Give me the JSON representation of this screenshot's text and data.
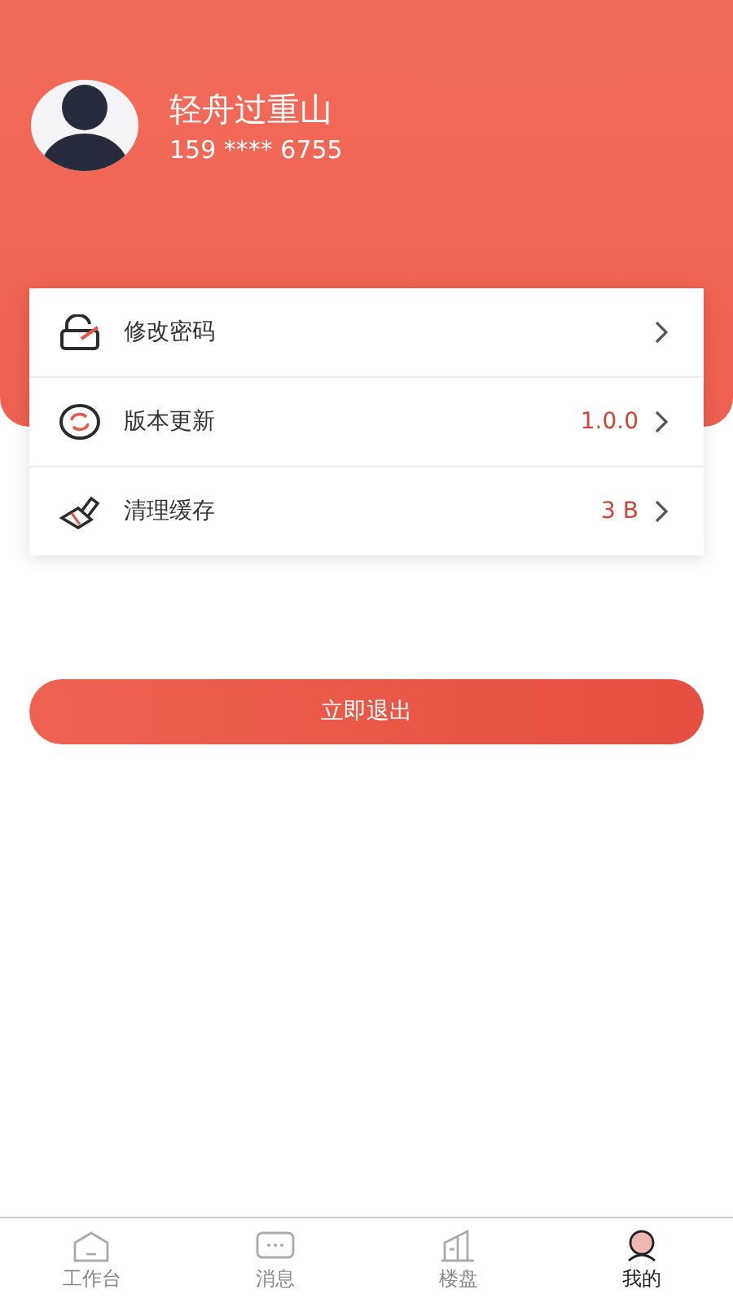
{
  "profile": {
    "name": "轻舟过重山",
    "phone": "159 **** 6755"
  },
  "menu": [
    {
      "kind": "password",
      "label": "修改密码"
    },
    {
      "kind": "update",
      "label": "版本更新",
      "value": "1.0.0"
    },
    {
      "kind": "cache",
      "label": "清理缓存",
      "value": "3 B"
    }
  ],
  "logout_button": "立即退出",
  "tabs": [
    {
      "kind": "workbench",
      "label": "工作台",
      "selected": false
    },
    {
      "kind": "messages",
      "label": "消息",
      "selected": false
    },
    {
      "kind": "buildings",
      "label": "楼盘",
      "selected": false
    },
    {
      "kind": "mine",
      "label": "我的",
      "selected": true
    }
  ]
}
